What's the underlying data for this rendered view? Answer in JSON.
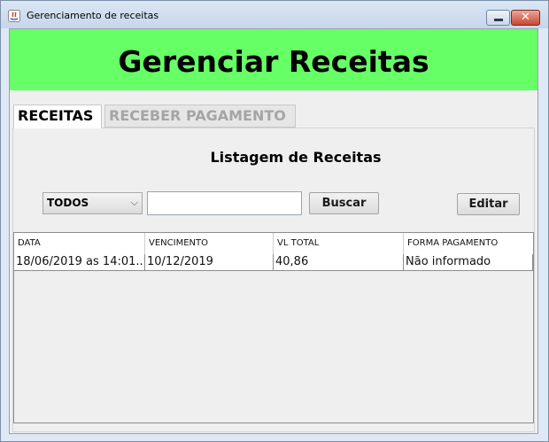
{
  "window": {
    "title": "Gerenciamento de receitas",
    "close_glyph": "✕"
  },
  "header": {
    "title": "Gerenciar Receitas",
    "color": "#66ff66"
  },
  "tabs": [
    {
      "label": "RECEITAS",
      "active": true
    },
    {
      "label": "RECEBER PAGAMENTO",
      "active": false
    }
  ],
  "panel": {
    "title": "Listagem de Receitas",
    "filter": {
      "selected": "TODOS",
      "arrow_glyph": "⌵"
    },
    "search": {
      "value": "",
      "placeholder": ""
    },
    "buttons": {
      "search_label": "Buscar",
      "edit_label": "Editar"
    }
  },
  "table": {
    "columns": [
      "DATA",
      "VENCIMENTO",
      "VL TOTAL",
      "FORMA PAGAMENTO"
    ],
    "rows": [
      [
        "18/06/2019 as 14:01...",
        "10/12/2019",
        "40,86",
        "Não informado"
      ]
    ]
  }
}
